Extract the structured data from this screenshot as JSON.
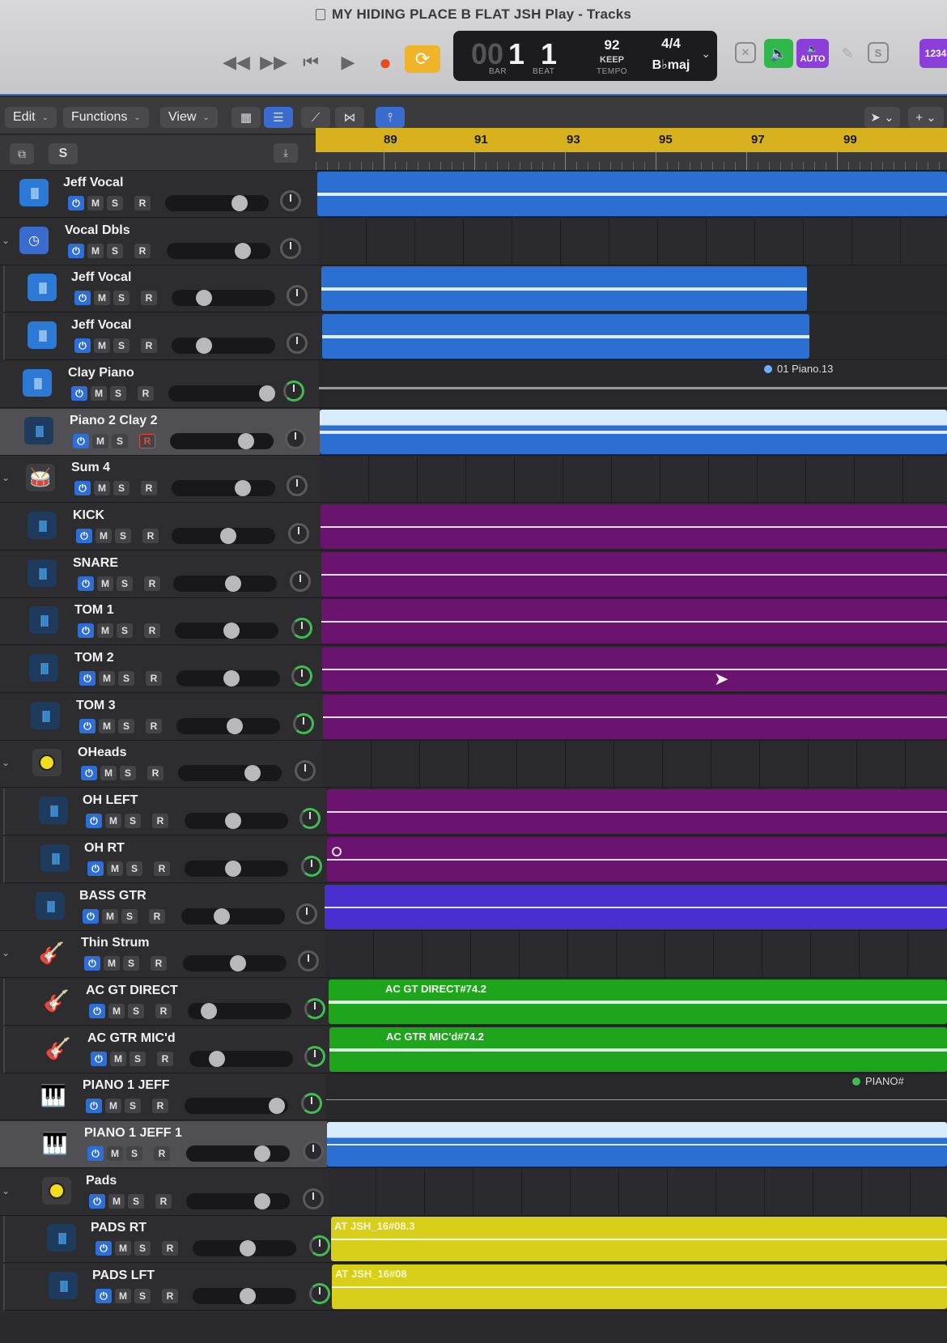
{
  "window": {
    "title": "MY HIDING PLACE B FLAT JSH Play - Tracks"
  },
  "transport": {
    "rewind_icon": "rewind-icon",
    "forward_icon": "fast-forward-icon",
    "tostart_icon": "go-to-start-icon",
    "play_icon": "play-icon",
    "record_icon": "record-icon",
    "cycle_icon": "cycle-icon",
    "lcd": {
      "bar_prefix": "00",
      "bar": "1",
      "beat": "1",
      "bar_label": "BAR",
      "beat_label": "BEAT",
      "tempo": "92",
      "tempo_mode": "KEEP",
      "tempo_label": "TEMPO",
      "time_signature": "4/4",
      "key": "B♭maj"
    },
    "auto_label": "AUTO",
    "s_label": "S",
    "numbers_label": "1234"
  },
  "toolbar": {
    "edit": "Edit",
    "functions": "Functions",
    "view": "View"
  },
  "header": {
    "solo_label": "S"
  },
  "ruler": {
    "bars": [
      "89",
      "91",
      "93",
      "95",
      "97",
      "99"
    ]
  },
  "controls": {
    "mute": "M",
    "solo": "S",
    "record": "R"
  },
  "tracks": [
    {
      "name": "Jeff Vocal"
    },
    {
      "name": "Vocal Dbls"
    },
    {
      "name": "Jeff Vocal"
    },
    {
      "name": "Jeff Vocal"
    },
    {
      "name": "Clay Piano"
    },
    {
      "name": "Piano 2 Clay 2"
    },
    {
      "name": "Sum 4"
    },
    {
      "name": "KICK"
    },
    {
      "name": "SNARE"
    },
    {
      "name": "TOM 1"
    },
    {
      "name": "TOM 2"
    },
    {
      "name": "TOM 3"
    },
    {
      "name": "OHeads"
    },
    {
      "name": "OH LEFT"
    },
    {
      "name": "OH  RT"
    },
    {
      "name": "BASS GTR"
    },
    {
      "name": "Thin Strum"
    },
    {
      "name": "AC GT DIRECT"
    },
    {
      "name": "AC GTR MIC'd"
    },
    {
      "name": "PIANO 1 JEFF"
    },
    {
      "name": "PIANO 1 JEFF 1"
    },
    {
      "name": "Pads"
    },
    {
      "name": "PADS RT"
    },
    {
      "name": "PADS LFT"
    }
  ],
  "regions": {
    "clay_piano_label": "01 Piano.13",
    "ac_gt_direct": "AC GT DIRECT#74.2",
    "ac_gtr_micd": "AC GTR MIC'd#74.2",
    "piano1_label": "PIANO#",
    "pads_rt": "AT JSH_16#08.3",
    "pads_lft": "AT JSH_16#08"
  },
  "colors": {
    "blue_region": "#2a6fd1",
    "purple_region": "#6a1470",
    "violet_region": "#4a2fd0",
    "green_region": "#1fa51c",
    "yellow_region": "#d7cf1a",
    "cycle": "#d8b21e"
  }
}
